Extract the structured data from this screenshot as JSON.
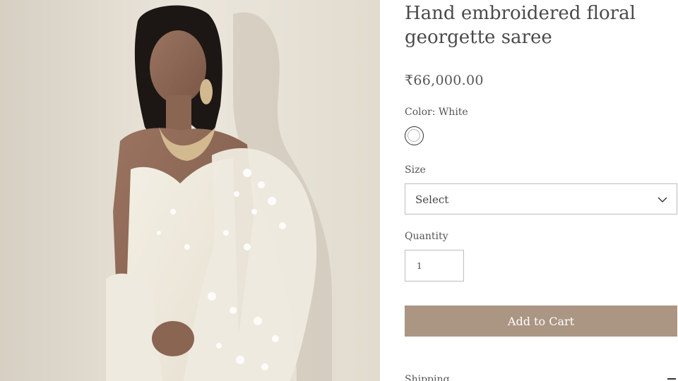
{
  "product": {
    "title": "Hand embroidered floral georgette saree",
    "price": "₹66,000.00",
    "color_label": "Color: White",
    "color_swatch": "#ffffff",
    "size_label": "Size",
    "size_value": "Select",
    "quantity_label": "Quantity",
    "quantity_value": "1",
    "add_to_cart": "Add to Cart",
    "shipping_label": "Shipping"
  },
  "theme": {
    "accent": "#ab9583",
    "text": "#4a4a4a",
    "border": "#bdbdbd"
  },
  "icons": {
    "dropdown": "chevron-down-icon",
    "collapse": "minus-icon"
  }
}
